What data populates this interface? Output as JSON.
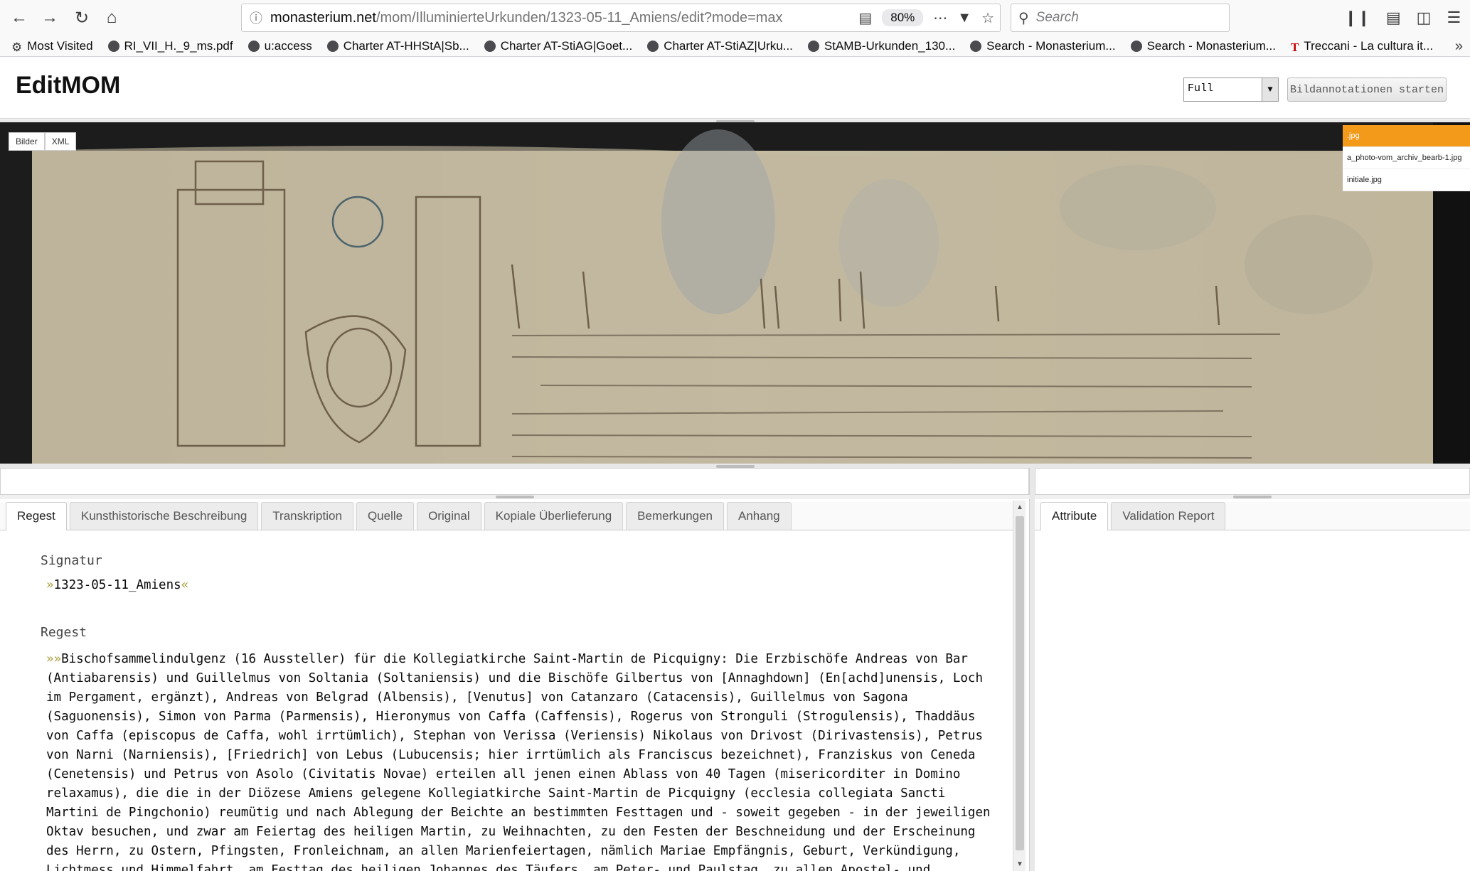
{
  "browser": {
    "url_host": "monasterium.net",
    "url_path": "/mom/IlluminierteUrkunden/1323-05-11_Amiens/edit?mode=max",
    "zoom": "80%",
    "search_placeholder": "Search"
  },
  "bookmarks": [
    {
      "label": "Most Visited",
      "icon": "gear-icon"
    },
    {
      "label": "RI_VII_H._9_ms.pdf",
      "icon": "globe-icon"
    },
    {
      "label": "u:access",
      "icon": "globe-icon"
    },
    {
      "label": "Charter AT-HHStA|Sb...",
      "icon": "globe-icon"
    },
    {
      "label": "Charter AT-StiAG|Goet...",
      "icon": "globe-icon"
    },
    {
      "label": "Charter AT-StiAZ|Urku...",
      "icon": "globe-icon"
    },
    {
      "label": "StAMB-Urkunden_130...",
      "icon": "globe-icon"
    },
    {
      "label": "Search - Monasterium...",
      "icon": "globe-icon"
    },
    {
      "label": "Search - Monasterium...",
      "icon": "globe-icon"
    },
    {
      "label": "Treccani - La cultura it...",
      "icon": "treccani-icon"
    }
  ],
  "app": {
    "title": "EditMOM",
    "mode_select": "Full",
    "annotation_button": "Bildannotationen starten"
  },
  "viewer": {
    "tabs": [
      "Bilder",
      "XML"
    ],
    "images": [
      ".jpg",
      "a_photo-vom_archiv_bearb-1.jpg",
      "initiale.jpg"
    ],
    "selected_image": 0
  },
  "editor": {
    "tabs": [
      "Regest",
      "Kunsthistorische Beschreibung",
      "Transkription",
      "Quelle",
      "Original",
      "Kopiale Überlieferung",
      "Bemerkungen",
      "Anhang"
    ],
    "active_tab": 0,
    "signatur_label": "Signatur",
    "signatur_value": "1323-05-11_Amiens",
    "regest_label": "Regest",
    "regest_text": "Bischofsammelindulgenz (16 Aussteller) für die Kollegiatkirche Saint-Martin de Picquigny: Die Erzbischöfe Andreas von Bar (Antiabarensis) und Guillelmus von Soltania (Soltaniensis) und die Bischöfe Gilbertus von [Annaghdown] (En[achd]unensis, Loch im Pergament, ergänzt), Andreas von Belgrad (Albensis), [Venutus] von Catanzaro (Catacensis), Guillelmus von Sagona (Saguonensis), Simon von Parma (Parmensis), Hieronymus von Caffa (Caffensis), Rogerus von Stronguli (Strogulensis), Thaddäus von Caffa (episcopus de Caffa, wohl irrtümlich), Stephan von Verissa (Veriensis) Nikolaus von Drivost (Dirivastensis), Petrus von Narni (Narniensis), [Friedrich] von Lebus (Lubucensis; hier irrtümlich als Franciscus bezeichnet), Franziskus von Ceneda (Cenetensis) und Petrus von Asolo (Civitatis Novae) erteilen all jenen einen Ablass von 40 Tagen (misericorditer in Domino relaxamus), die die in der Diözese Amiens gelegene Kollegiatkirche Saint-Martin de Picquigny (ecclesia collegiata Sancti Martini de Pingchonio) reumütig und nach Ablegung der Beichte an bestimmten Festtagen und - soweit gegeben - in der jeweiligen Oktav besuchen, und zwar am Feiertag des heiligen Martin, zu Weihnachten, zu den Festen der Beschneidung und der Erscheinung des Herrn, zu Ostern, Pfingsten, Fronleichnam, an allen Marienfeiertagen, nämlich Mariae Empfängnis, Geburt, Verkündigung, Lichtmess und Himmelfahrt, am Festtag des heiligen Johannes des Täufers, am Peter- und Paulstag, zu allen Apostel- und"
  },
  "side": {
    "tabs": [
      "Attribute",
      "Validation Report"
    ],
    "active_tab": 0
  },
  "colors": {
    "selected_image": "#f39a1b",
    "marker": "#a8a040"
  }
}
